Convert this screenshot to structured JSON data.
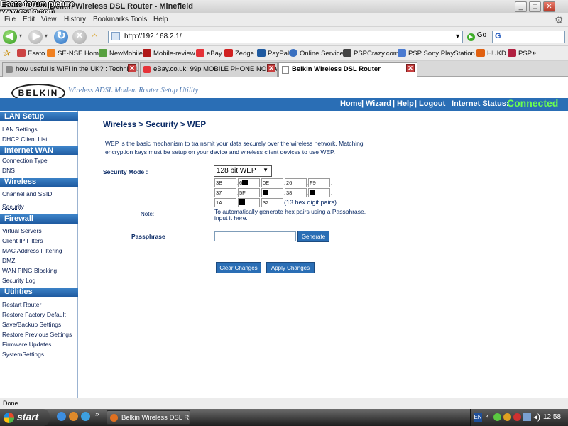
{
  "watermark": {
    "line1": "Esato forum picture",
    "line2": "www.esato.com"
  },
  "window": {
    "title": "Belkin Wireless DSL Router - Minefield"
  },
  "menu": [
    "File",
    "Edit",
    "View",
    "History",
    "Bookmarks",
    "Tools",
    "Help"
  ],
  "nav": {
    "url": "http://192.168.2.1/",
    "go_label": "Go"
  },
  "bookmarks": [
    "Esato",
    "SE-NSE Home",
    "NewMobile",
    "Mobile-review",
    "eBay",
    "Zedge",
    "PayPal",
    "Online Service",
    "PSPCrazy.com",
    "PSP Sony PlayStation ...",
    "HUKD",
    "PSP",
    "»"
  ],
  "tabs": [
    {
      "label": "how useful is WiFi in the UK? : Technical..."
    },
    {
      "label": "eBay.co.uk: 99p MOBILE PHONE NOKIA ..."
    },
    {
      "label": "Belkin Wireless DSL Router"
    }
  ],
  "header": {
    "logo": "BELKIN",
    "tagline": "Wireless ADSL Modem Router Setup Utility",
    "links": [
      "Home",
      "Wizard",
      "Help",
      "Logout"
    ],
    "status_label": "Internet Status:",
    "status_value": "Connected",
    "status_color": "#6cff4f",
    "bar_color": "#2a6eb5"
  },
  "sidebar": {
    "sections": [
      {
        "title": "LAN Setup",
        "items": [
          "LAN Settings",
          "DHCP Client List"
        ]
      },
      {
        "title": "Internet WAN",
        "items": [
          "Connection Type",
          "DNS"
        ]
      },
      {
        "title": "Wireless",
        "items": [
          "Channel and SSID",
          "Security"
        ]
      },
      {
        "title": "Firewall",
        "items": [
          "Virtual Servers",
          "Client IP Filters",
          "MAC Address Filtering",
          "DMZ",
          "WAN PING Blocking",
          "Security Log"
        ]
      },
      {
        "title": "Utilities",
        "items": [
          "Restart Router",
          "Restore Factory Default",
          "Save/Backup Settings",
          "Restore Previous Settings",
          "Firmware Updates",
          "SystemSettings"
        ]
      }
    ]
  },
  "content": {
    "title": "Wireless > Security > WEP",
    "desc_line1": "WEP is the basic mechanism to tra nsmit your data securely over the wireless network. Matching",
    "desc_line2": "encryption keys must be setup on  your device and wireless client devices to use WEP.",
    "security_mode_label": "Security Mode :",
    "security_mode_value": "128 bit WEP",
    "hex_rows": [
      [
        "3B",
        "6",
        "0E",
        "26",
        "F9"
      ],
      [
        "37",
        "5F",
        "",
        "38",
        ""
      ],
      [
        "1A",
        "",
        "32"
      ]
    ],
    "hex_note": "(13 hex digit pairs)",
    "note_label": "Note:",
    "note_line1": "To automatically generate hex pairs using a Passphrase,",
    "note_line2": "input it here.",
    "passphrase_label": "Passphrase",
    "passphrase_value": "",
    "generate_label": "Generate",
    "clear_label": "Clear Changes",
    "apply_label": "Apply Changes"
  },
  "statusbar": {
    "text": "Done"
  },
  "taskbar": {
    "start_label": "start",
    "window_label": "Belkin Wireless DSL R...",
    "clock": "12:58"
  }
}
